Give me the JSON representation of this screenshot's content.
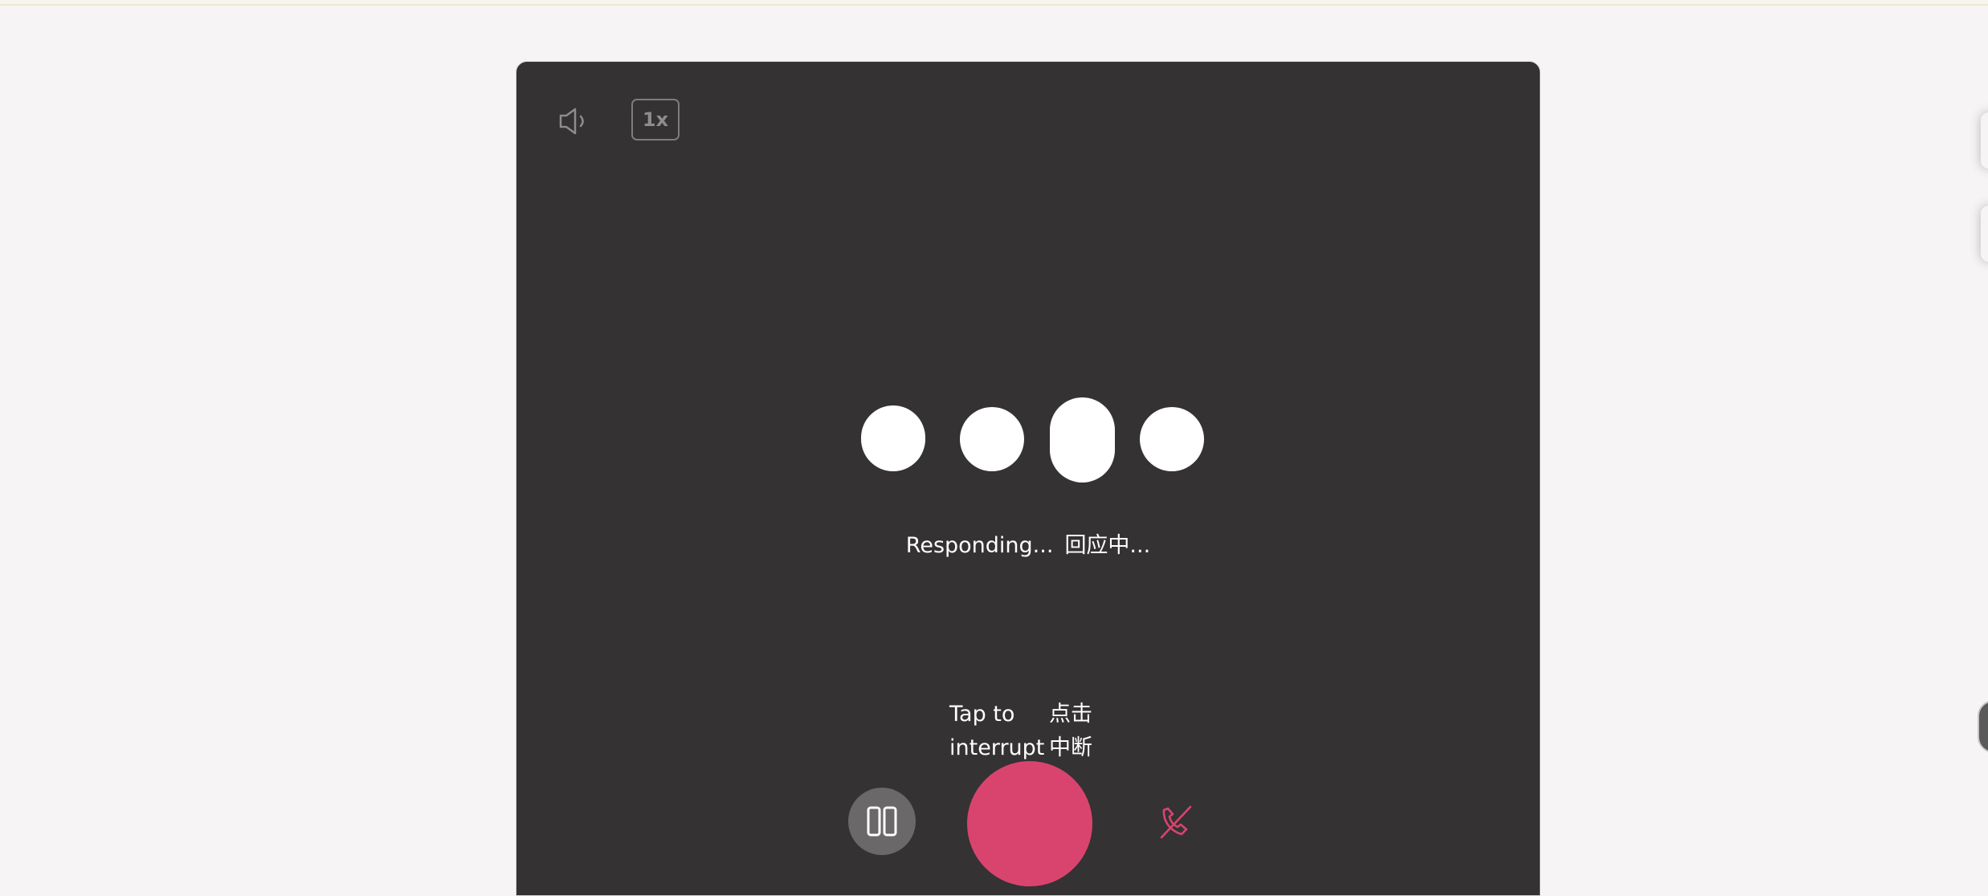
{
  "player": {
    "speaker_icon": "speaker-icon",
    "speed_label": "1x"
  },
  "indicator": {
    "status_en": "Responding...",
    "status_zh": "回应中..."
  },
  "interrupt_hint": {
    "en_line1": "Tap to",
    "en_line2": "interrupt",
    "zh_line1": "点击",
    "zh_line2": "中断"
  },
  "controls": {
    "pause_icon": "pause-icon",
    "hangup_icon": "hang-up-icon"
  },
  "colors": {
    "page_bg": "#f6f4f5",
    "panel_bg": "#343233",
    "accent": "#d9446f",
    "pause_bg": "#6a6869"
  }
}
